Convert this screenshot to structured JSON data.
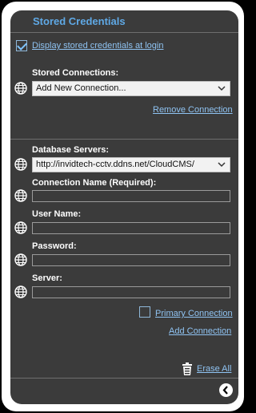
{
  "header": {
    "title": "Stored Credentials"
  },
  "display_login": {
    "label": "Display stored credentials at login",
    "checked": true
  },
  "stored_connections": {
    "label": "Stored Connections:",
    "selected": "Add New Connection...",
    "remove_label": "Remove Connection"
  },
  "database_servers": {
    "label": "Database Servers:",
    "selected": "http://invidtech-cctv.ddns.net/CloudCMS/"
  },
  "fields": {
    "connection_name": {
      "label": "Connection Name (Required):",
      "value": ""
    },
    "user_name": {
      "label": "User Name:",
      "value": ""
    },
    "password": {
      "label": "Password:",
      "value": ""
    },
    "server": {
      "label": "Server:",
      "value": ""
    }
  },
  "primary_connection": {
    "label": "Primary Connection",
    "checked": false
  },
  "add_connection_label": "Add Connection",
  "erase_all_label": "Erase All",
  "icons": {
    "field": "globe-icon",
    "dropdown": "chevron-down-icon",
    "erase": "trash-icon",
    "back": "chevron-left-circle-icon"
  },
  "colors": {
    "panel_bg": "#3b3b3b",
    "title": "#5fa9e6",
    "link": "#8fc3f2",
    "frame": "#ffffff"
  }
}
